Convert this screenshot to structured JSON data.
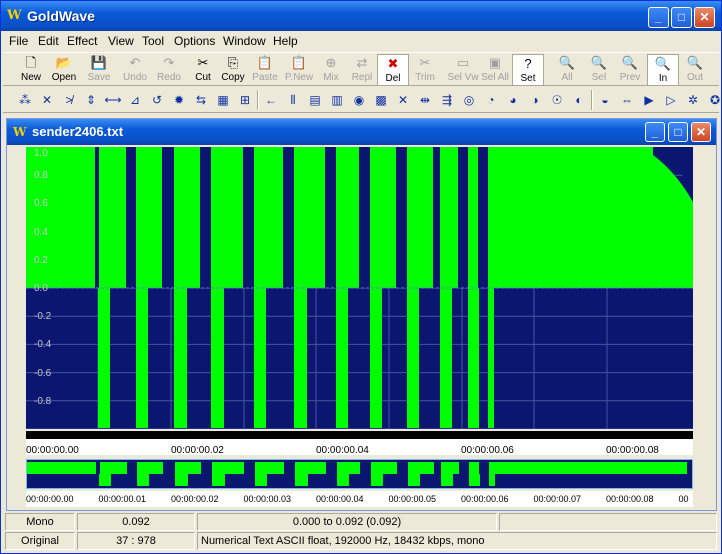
{
  "app": {
    "title": "GoldWave",
    "icon": "goldwave-logo-icon"
  },
  "menu": [
    "File",
    "Edit",
    "Effect",
    "View",
    "Tool",
    "Options",
    "Window",
    "Help"
  ],
  "toolbar": [
    {
      "label": "New",
      "icon": "new-file-icon",
      "enabled": true
    },
    {
      "label": "Open",
      "icon": "open-folder-icon",
      "enabled": true
    },
    {
      "label": "Save",
      "icon": "save-disk-icon",
      "enabled": false
    },
    {
      "label": "Undo",
      "icon": "undo-icon",
      "enabled": false
    },
    {
      "label": "Redo",
      "icon": "redo-icon",
      "enabled": false
    },
    {
      "label": "Cut",
      "icon": "scissors-icon",
      "enabled": true
    },
    {
      "label": "Copy",
      "icon": "copy-icon",
      "enabled": true
    },
    {
      "label": "Paste",
      "icon": "paste-icon",
      "enabled": false
    },
    {
      "label": "P.New",
      "icon": "paste-new-icon",
      "enabled": false
    },
    {
      "label": "Mix",
      "icon": "mix-icon",
      "enabled": false
    },
    {
      "label": "Repl",
      "icon": "replace-icon",
      "enabled": false
    },
    {
      "label": "Del",
      "icon": "delete-icon",
      "enabled": true
    },
    {
      "label": "Trim",
      "icon": "trim-icon",
      "enabled": false
    },
    {
      "label": "Sel Vw",
      "icon": "select-view-icon",
      "enabled": false
    },
    {
      "label": "Sel All",
      "icon": "select-all-icon",
      "enabled": false
    },
    {
      "label": "Set",
      "icon": "set-marker-icon",
      "enabled": true
    },
    {
      "label": "All",
      "icon": "zoom-all-icon",
      "enabled": false
    },
    {
      "label": "Sel",
      "icon": "zoom-selection-icon",
      "enabled": false
    },
    {
      "label": "Prev",
      "icon": "zoom-previous-icon",
      "enabled": false
    },
    {
      "label": "In",
      "icon": "zoom-in-icon",
      "enabled": true
    },
    {
      "label": "Out",
      "icon": "zoom-out-icon",
      "enabled": false
    }
  ],
  "document": {
    "title": "sender2406.txt",
    "y_labels": [
      "1.0",
      "0.8",
      "0.6",
      "0.4",
      "0.2",
      "0.0",
      "-0.2",
      "-0.4",
      "-0.6",
      "-0.8"
    ],
    "time_labels": [
      "00:00:00.00",
      "00:00:00.02",
      "00:00:00.04",
      "00:00:00.06",
      "00:00:00.08"
    ],
    "overview_time_labels": [
      "00:00:00.00",
      "00:00:00.01",
      "00:00:00.02",
      "00:00:00.03",
      "00:00:00.04",
      "00:00:00.05",
      "00:00:00.06",
      "00:00:00.07",
      "00:00:00.08",
      "00"
    ],
    "colors": {
      "wave": "#00ff00",
      "background": "#0b1670",
      "grid": "#4555a0"
    }
  },
  "status": {
    "channel": "Mono",
    "length": "0.092",
    "selection": "0.000 to 0.092 (0.092)",
    "mode": "Original",
    "position": "37 : 978",
    "format": "Numerical Text ASCII float, 192000 Hz, 18432 kbps, mono"
  }
}
